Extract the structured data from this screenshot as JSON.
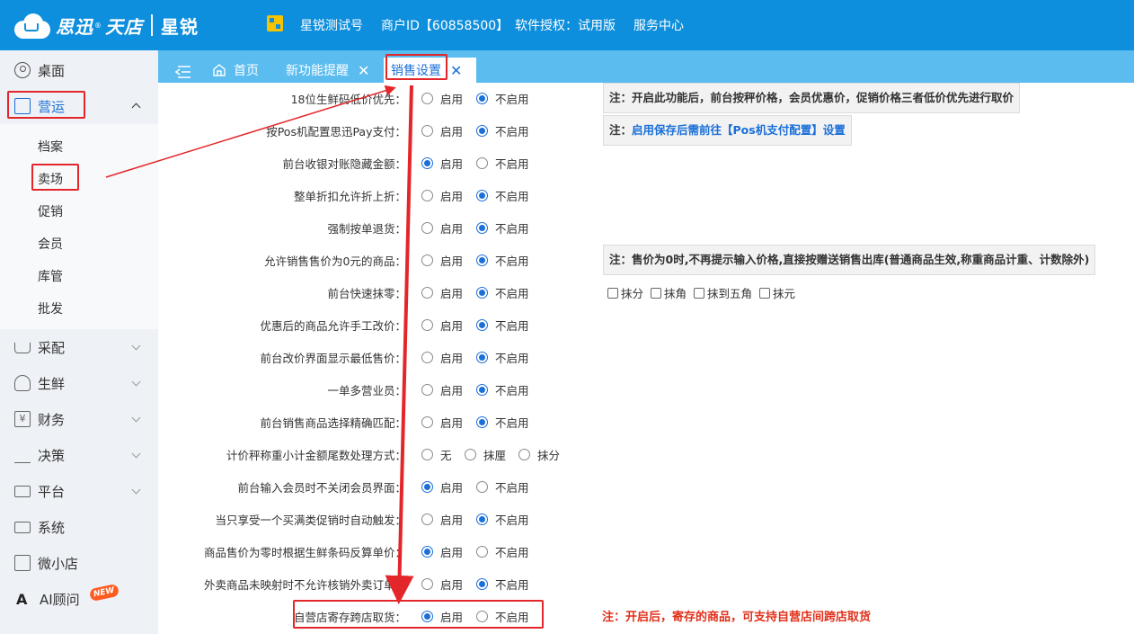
{
  "header": {
    "logo_main": "思迅",
    "logo_reg": "®",
    "logo_brand": "天店",
    "logo_sub": "星锐",
    "account_name": "星锐测试号",
    "merchant_id": "商户ID【60858500】",
    "license": "软件授权：试用版",
    "service_center": "服务中心"
  },
  "sidebar": {
    "desktop": "桌面",
    "operations": "营运",
    "operations_sub": [
      "档案",
      "卖场",
      "促销",
      "会员",
      "库管",
      "批发"
    ],
    "purchase": "采配",
    "fresh": "生鲜",
    "finance": "财务",
    "decision": "决策",
    "platform": "平台",
    "system": "系统",
    "micro_shop": "微小店",
    "ai_advisor": "AI顾问",
    "new_badge": "NEW"
  },
  "tabs": {
    "home": "首页",
    "new_feature": "新功能提醒",
    "sales_settings": "销售设置"
  },
  "settings": {
    "rows": [
      {
        "label": "18位生鲜码低价优先：",
        "options": [
          "启用",
          "不启用"
        ],
        "selected": 1
      },
      {
        "label": "按Pos机配置思迅Pay支付：",
        "options": [
          "启用",
          "不启用"
        ],
        "selected": 1
      },
      {
        "label": "前台收银对账隐藏金额：",
        "options": [
          "启用",
          "不启用"
        ],
        "selected": 0
      },
      {
        "label": "整单折扣允许折上折：",
        "options": [
          "启用",
          "不启用"
        ],
        "selected": 1
      },
      {
        "label": "强制按单退货：",
        "options": [
          "启用",
          "不启用"
        ],
        "selected": 1
      },
      {
        "label": "允许销售售价为0元的商品：",
        "options": [
          "启用",
          "不启用"
        ],
        "selected": 1
      },
      {
        "label": "前台快速抹零：",
        "options": [
          "启用",
          "不启用"
        ],
        "selected": 1
      },
      {
        "label": "优惠后的商品允许手工改价：",
        "options": [
          "启用",
          "不启用"
        ],
        "selected": 1
      },
      {
        "label": "前台改价界面显示最低售价：",
        "options": [
          "启用",
          "不启用"
        ],
        "selected": 1
      },
      {
        "label": "一单多营业员：",
        "options": [
          "启用",
          "不启用"
        ],
        "selected": 1
      },
      {
        "label": "前台销售商品选择精确匹配：",
        "options": [
          "启用",
          "不启用"
        ],
        "selected": 1
      },
      {
        "label": "计价秤称重小计金额尾数处理方式：",
        "options": [
          "无",
          "抹厘",
          "抹分"
        ],
        "selected": -1
      },
      {
        "label": "前台输入会员时不关闭会员界面：",
        "options": [
          "启用",
          "不启用"
        ],
        "selected": 0
      },
      {
        "label": "当只享受一个买满类促销时自动触发：",
        "options": [
          "启用",
          "不启用"
        ],
        "selected": 1
      },
      {
        "label": "商品售价为零时根据生鲜条码反算单价：",
        "options": [
          "启用",
          "不启用"
        ],
        "selected": 0
      },
      {
        "label": "外卖商品未映射时不允许核销外卖订单：",
        "options": [
          "启用",
          "不启用"
        ],
        "selected": 1
      },
      {
        "label": "自营店寄存跨店取货：",
        "options": [
          "启用",
          "不启用"
        ],
        "selected": 0
      }
    ],
    "notes": {
      "note1": "注：开启此功能后，前台按秤价格，会员优惠价，促销价格三者低价优先进行取价",
      "note2_prefix": "注：",
      "note2_link": "启用保存后需前往【Pos机支付配置】设置",
      "note3": "注：售价为0时,不再提示输入价格,直接按赠送销售出库(普通商品生效,称重商品计重、计数除外)",
      "note4": "注：开启后，寄存的商品，可支持自营店间跨店取货"
    },
    "rounding_options": [
      "抹分",
      "抹角",
      "抹到五角",
      "抹元"
    ]
  },
  "colors": {
    "header_bg": "#0e8fdd",
    "tabbar_bg": "#5bbcef",
    "accent": "#1a6fd8",
    "annotation_red": "#e3262a"
  }
}
